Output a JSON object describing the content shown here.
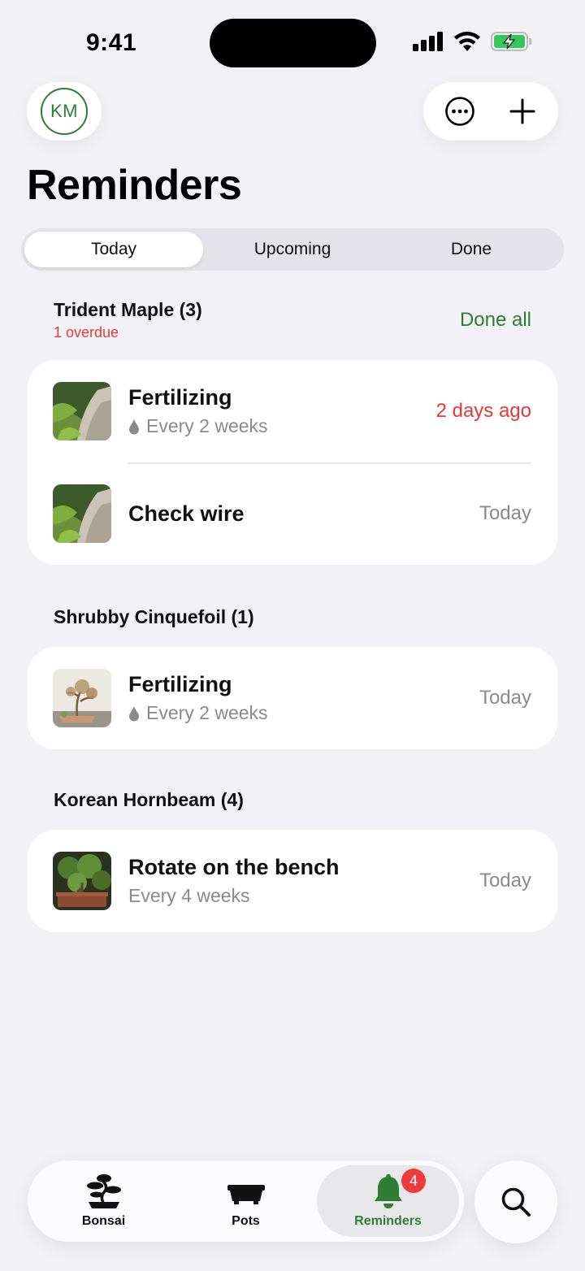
{
  "status_bar": {
    "time": "9:41"
  },
  "header": {
    "avatar_initials": "KM",
    "title": "Reminders",
    "actions": {
      "more_icon": "ellipsis-circle-icon",
      "add_icon": "plus-icon"
    }
  },
  "tabs": [
    {
      "label": "Today",
      "active": true
    },
    {
      "label": "Upcoming",
      "active": false
    },
    {
      "label": "Done",
      "active": false
    }
  ],
  "groups": [
    {
      "title": "Trident Maple (3)",
      "subtitle": "1 overdue",
      "action": "Done all",
      "items": [
        {
          "title": "Fertilizing",
          "detail": "Every 2 weeks",
          "detail_icon": "drop-icon",
          "time": "2 days ago",
          "overdue": true
        },
        {
          "title": "Check wire",
          "time": "Today",
          "overdue": false
        }
      ]
    },
    {
      "title": "Shrubby Cinquefoil (1)",
      "items": [
        {
          "title": "Fertilizing",
          "detail": "Every 2 weeks",
          "detail_icon": "drop-icon",
          "time": "Today",
          "overdue": false
        }
      ]
    },
    {
      "title": "Korean Hornbeam (4)",
      "items": [
        {
          "title": "Rotate on the bench",
          "detail": "Every 4 weeks",
          "time": "Today",
          "overdue": false
        }
      ]
    }
  ],
  "tab_bar": {
    "items": [
      {
        "label": "Bonsai",
        "icon": "bonsai-tree-icon",
        "active": false
      },
      {
        "label": "Pots",
        "icon": "pot-icon",
        "active": false
      },
      {
        "label": "Reminders",
        "icon": "bell-icon",
        "active": true,
        "badge": "4"
      }
    ],
    "search_icon": "search-icon"
  },
  "colors": {
    "accent": "#2e7d32",
    "overdue": "#e53935",
    "badge": "#ef3b3b",
    "background": "#f2f1f6"
  }
}
